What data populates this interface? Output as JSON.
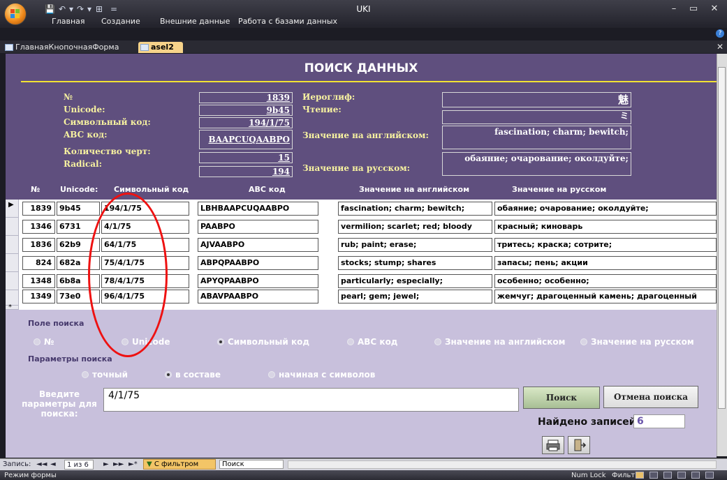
{
  "window": {
    "title": "UKI",
    "controls": {
      "minimize": "–",
      "maximize": "▭",
      "close": "✕"
    },
    "quick_access": [
      "💾",
      "↶",
      "▾",
      "↷",
      "▾",
      "⊞",
      "="
    ]
  },
  "ribbon": {
    "menu": [
      "Главная",
      "Создание",
      "Внешние данные",
      "Работа с базами данных"
    ],
    "help": "?"
  },
  "doc_tabs": [
    {
      "label": "ГлавнаяКнопочнаяФорма"
    },
    {
      "label": "asel2"
    }
  ],
  "doc_close": "✕",
  "form": {
    "title": "ПОИСК ДАННЫХ",
    "fields_left": [
      {
        "label": "№",
        "value": "1839"
      },
      {
        "label": "Unicode:",
        "value": "9b45"
      },
      {
        "label": "Символьный код:",
        "value": "194/1/75"
      },
      {
        "label": "ABC код:",
        "value": "BAAPCUQAABPO"
      },
      {
        "label": "Количество черт:",
        "value": "15"
      },
      {
        "label": "Radical:",
        "value": "194"
      }
    ],
    "fields_right": [
      {
        "label": "Иероглиф:",
        "value": "魅"
      },
      {
        "label": "Чтение:",
        "value": "ミ"
      },
      {
        "label": "Значение на английском:",
        "value": "fascination; charm; bewitch;"
      },
      {
        "label": "Значение на русском:",
        "value": "обаяние; очарование; околдуйте;"
      }
    ]
  },
  "table": {
    "columns": [
      "№",
      "Unicode:",
      "Символьный код",
      "ABC код",
      "Значение на английском",
      "Значение на русском"
    ],
    "rows": [
      [
        "1839",
        "9b45",
        "194/1/75",
        "LBHBAAPCUQAABPO",
        "fascination; charm; bewitch;",
        "обаяние; очарование; околдуйте;"
      ],
      [
        "1346",
        "6731",
        "4/1/75",
        "PAABPO",
        "vermilion; scarlet; red; bloody",
        "красный; киноварь"
      ],
      [
        "1836",
        "62b9",
        "64/1/75",
        "AJVAABPO",
        "rub; paint; erase;",
        "тритесь; краска; сотрите;"
      ],
      [
        "824",
        "682a",
        "75/4/1/75",
        "ABPQPAABPO",
        "stocks; stump; shares",
        "запасы; пень; акции"
      ],
      [
        "1348",
        "6b8a",
        "78/4/1/75",
        "APYQPAABPO",
        "particularly; especially;",
        "особенно; особенно;"
      ],
      [
        "1349",
        "73e0",
        "96/4/1/75",
        "ABAVPAABPO",
        "pearl; gem; jewel;",
        "жемчуг; драгоценный камень; драгоценный"
      ]
    ],
    "current_marker": "▶",
    "new_marker": "*"
  },
  "search": {
    "field_section": "Поле поиска",
    "field_options": [
      {
        "label": "№",
        "selected": false
      },
      {
        "label": "Unicode",
        "selected": false
      },
      {
        "label": "Символьный код",
        "selected": true
      },
      {
        "label": "ABC код",
        "selected": false
      },
      {
        "label": "Значение на английском",
        "selected": false
      },
      {
        "label": "Значение на русском",
        "selected": false
      }
    ],
    "params_section": "Параметры поиска",
    "param_options": [
      {
        "label": "точный",
        "selected": false
      },
      {
        "label": "в составе",
        "selected": true
      },
      {
        "label": "начиная с символов",
        "selected": false
      }
    ],
    "prompt": "Введите параметры для поиска:",
    "query": "4/1/75",
    "search_button": "Поиск",
    "cancel_button": "Отмена поиска",
    "found_label": "Найдено записей:",
    "found_count": "6"
  },
  "record_nav": {
    "label": "Запись:",
    "first": "◄◄",
    "prev": "◄",
    "position": "1 из 6",
    "next": "►",
    "last": "►►",
    "new": "►*",
    "filter": "С фильтром",
    "search": "Поиск"
  },
  "status": {
    "mode": "Режим формы",
    "numlock": "Num Lock",
    "filter": "Фильтр"
  },
  "colors": {
    "form_bg": "#5f4f7e",
    "label_yellow": "#f7f2a0",
    "title_rule": "#f2e233",
    "lower_bg": "#c8c0dc",
    "annotation": "#e11111"
  }
}
